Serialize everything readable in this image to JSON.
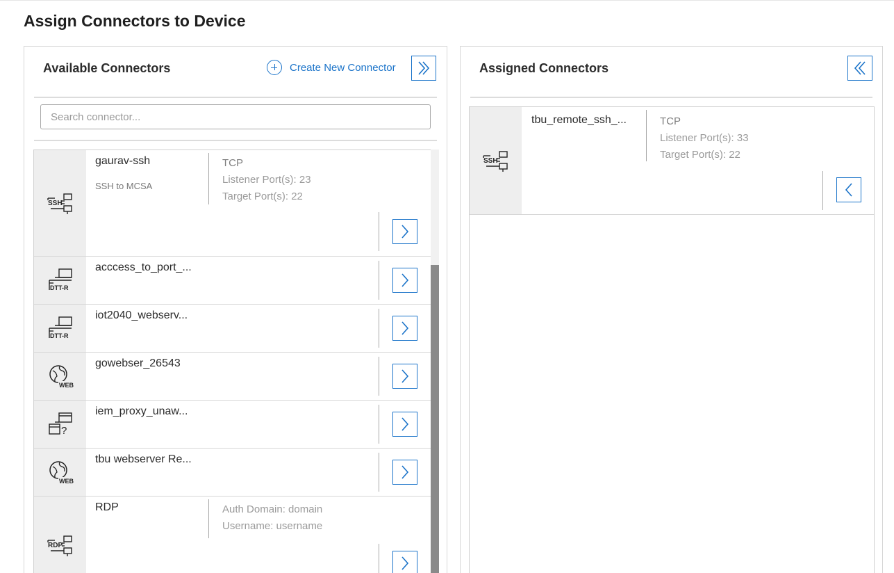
{
  "page_title": "Assign Connectors to Device",
  "available": {
    "title": "Available Connectors",
    "create_label": "Create New Connector",
    "search_placeholder": "Search connector...",
    "items": [
      {
        "name": "gaurav-ssh",
        "description": "SSH to MCSA",
        "icon": "ssh-icon",
        "details": [
          "TCP",
          "Listener Port(s): 23",
          "Target Port(s): 22"
        ]
      },
      {
        "name": "acccess_to_port_...",
        "icon": "dtt-r-icon"
      },
      {
        "name": "iot2040_webserv...",
        "icon": "dtt-r-icon"
      },
      {
        "name": "gowebser_26543",
        "icon": "web-globe-icon"
      },
      {
        "name": "iem_proxy_unaw...",
        "icon": "unknown-connector-icon"
      },
      {
        "name": "tbu webserver Re...",
        "icon": "web-globe-icon"
      },
      {
        "name": "RDP",
        "icon": "rdp-icon",
        "details": [
          "Auth Domain: domain",
          "Username: username"
        ]
      }
    ]
  },
  "assigned": {
    "title": "Assigned Connectors",
    "items": [
      {
        "name": "tbu_remote_ssh_...",
        "icon": "ssh-icon",
        "details": [
          "TCP",
          "Listener Port(s): 33",
          "Target Port(s): 22"
        ]
      }
    ]
  },
  "colors": {
    "accent": "#1a73c9",
    "icon_bg": "#eeeeee",
    "scrollbar": "#8a8a8a"
  }
}
